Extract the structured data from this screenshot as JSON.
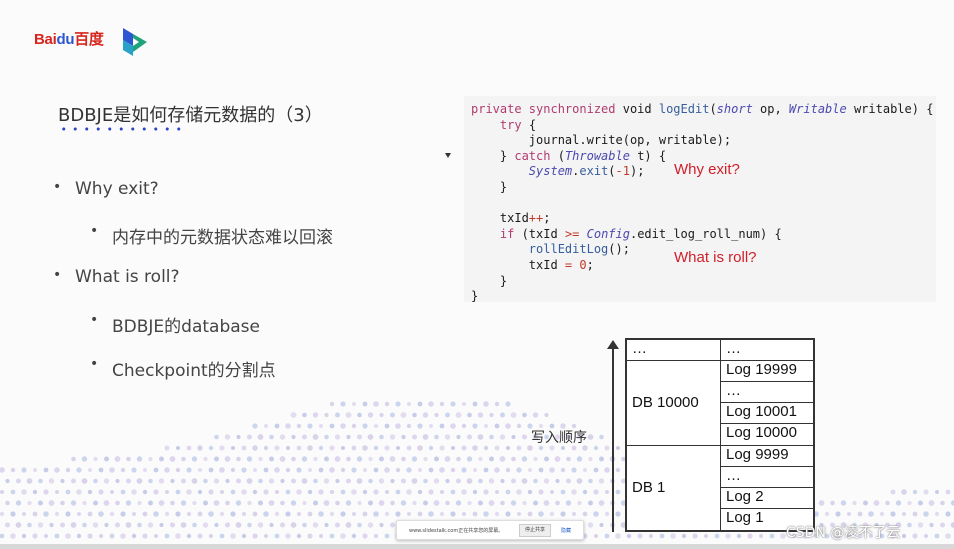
{
  "header": {
    "logo_text_1": "Bai",
    "logo_text_2": "du",
    "logo_text_3": "百度",
    "colors": {
      "baidu_red": "#d7261d",
      "baidu_blue": "#2d56d2",
      "accent_dots": "#2b45c9"
    }
  },
  "slide": {
    "title": "BDBJE是如何存储元数据的（3）",
    "bullets": [
      {
        "text": "Why exit?",
        "level": 1
      },
      {
        "text": "内存中的元数据状态难以回滚",
        "level": 2
      },
      {
        "text": "What is roll?",
        "level": 1
      },
      {
        "text": "BDBJE的database",
        "level": 2
      },
      {
        "text": "Checkpoint的分割点",
        "level": 2
      }
    ],
    "bullet_symbol": "•"
  },
  "code": {
    "lines": [
      "private synchronized void logEdit(short op, Writable writable) {",
      "    try {",
      "        journal.write(op, writable);",
      "    } catch (Throwable t) {",
      "        System.exit(-1);",
      "    }",
      "",
      "    txId++;",
      "    if (txId >= Config.edit_log_roll_num) {",
      "        rollEditLog();",
      "        txId = 0;",
      "    }",
      "}"
    ],
    "annotation_1": "Why exit?",
    "annotation_2": "What is roll?"
  },
  "diagram": {
    "order_label": "写入顺序",
    "left_col": [
      "…",
      "DB 10000",
      "DB 1"
    ],
    "right_col": [
      "…",
      "Log 19999",
      "…",
      "Log 10001",
      "Log 10000",
      "Log 9999",
      "…",
      "Log 2",
      "Log 1"
    ]
  },
  "share_bar": {
    "message": "www.slidestalk.com正在共享您的屏幕。",
    "stop_label": "停止共享",
    "hide_label": "隐藏"
  },
  "watermark": "CSDN @凌不了云"
}
